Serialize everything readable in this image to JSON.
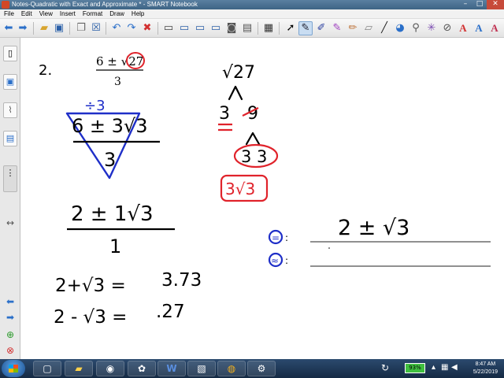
{
  "window": {
    "title": "Notes-Quadratic with Exact and Approximate * - SMART Notebook",
    "controls": [
      "–",
      "□",
      "✕"
    ]
  },
  "menu": [
    "File",
    "Edit",
    "View",
    "Insert",
    "Format",
    "Draw",
    "Help"
  ],
  "toolbar": {
    "buttons": [
      "back-arrow-icon",
      "forward-arrow-icon",
      "open-folder-icon",
      "save-icon",
      "paste-icon",
      "delete-page-icon",
      "undo-icon",
      "redo-icon",
      "delete-icon",
      "screen-shade-icon",
      "display-icon",
      "capture-icon",
      "table-icon",
      "select-arrow-icon",
      "pen-icon",
      "creative-pen-icon",
      "highlighter-icon",
      "eraser-icon",
      "line-icon",
      "shape-icon",
      "magic-pen-icon",
      "fill-icon",
      "text-icon",
      "properties-icon"
    ]
  },
  "sidetabs": [
    "page-sorter-icon",
    "gallery-icon",
    "attachments-icon",
    "properties-icon"
  ],
  "lesson": {
    "problem_number": "2.",
    "given": {
      "numerator": "6 ± √27",
      "denominator": "3",
      "highlighted": "27"
    },
    "factor": {
      "root": "√27",
      "left_branch": "3",
      "right_branch": "9",
      "sub_branches": "3 3",
      "result": "3√3"
    },
    "step1": {
      "divide_note": "÷3",
      "numerator": "6 ± 3√3",
      "denominator": "3"
    },
    "step2": {
      "numerator": "2 ± 1√3",
      "denominator": "1"
    },
    "approximations": [
      {
        "expr": "2+√3 =",
        "value": "3.73"
      },
      {
        "expr": "2 - √3 =",
        "value": ".27"
      }
    ],
    "answers": [
      {
        "symbol": "=",
        "label": ":",
        "value": "2 ± √3"
      },
      {
        "symbol": "≈",
        "label": ":",
        "value": ""
      }
    ]
  },
  "colors": {
    "ink_black": "#000000",
    "ink_blue": "#1f2fc8",
    "ink_red": "#e0232b"
  },
  "taskbar": {
    "apps": [
      "windows-explorer-icon",
      "folder-icon",
      "smart-tools-icon",
      "word-icon",
      "notebook-icon",
      "chrome-icon",
      "settings-icon"
    ],
    "battery": "93%",
    "time": "8:47 AM",
    "date": "5/22/2019"
  }
}
